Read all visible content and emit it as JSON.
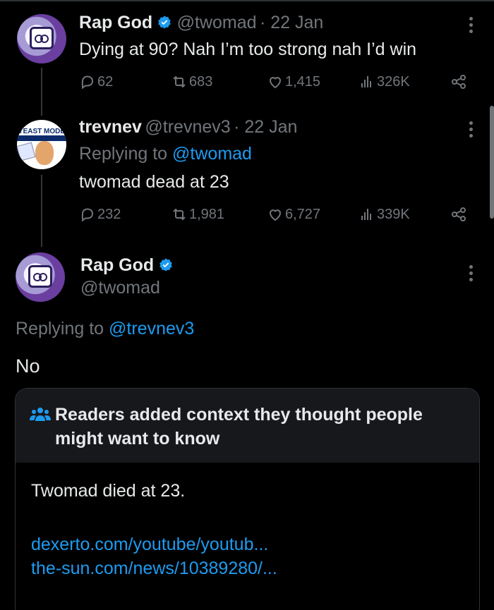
{
  "tweets": [
    {
      "name": "Rap God",
      "handle": "@twomad",
      "date": "· 22 Jan",
      "text": "Dying at 90? Nah I’m too strong nah I’d win",
      "stats": {
        "replies": "62",
        "reposts": "683",
        "likes": "1,415",
        "views": "326K"
      }
    },
    {
      "name": "trevnev",
      "handle": "@trevnev3",
      "date": "· 22 Jan",
      "replying_prefix": "Replying to",
      "replying_to": "@twomad",
      "text": "twomad dead at 23",
      "avatar_banner": "YEAST MODE",
      "stats": {
        "replies": "232",
        "reposts": "1,981",
        "likes": "6,727",
        "views": "339K"
      }
    }
  ],
  "focus": {
    "name": "Rap God",
    "handle": "@twomad",
    "replying_prefix": "Replying to",
    "replying_to": "@trevnev3",
    "text": "No"
  },
  "community_note": {
    "title": "Readers added context they thought people might want to know",
    "text": "Twomad died at 23.",
    "links": [
      "dexerto.com/youtube/youtub...",
      "the-sun.com/news/10389280/..."
    ]
  },
  "colors": {
    "accent": "#1d9bf0",
    "muted": "#71767b",
    "text": "#e7e9ea",
    "background": "#000000"
  },
  "icons": [
    "reply-icon",
    "repost-icon",
    "like-icon",
    "views-icon",
    "share-icon",
    "verified-icon",
    "more-icon",
    "people-icon"
  ]
}
